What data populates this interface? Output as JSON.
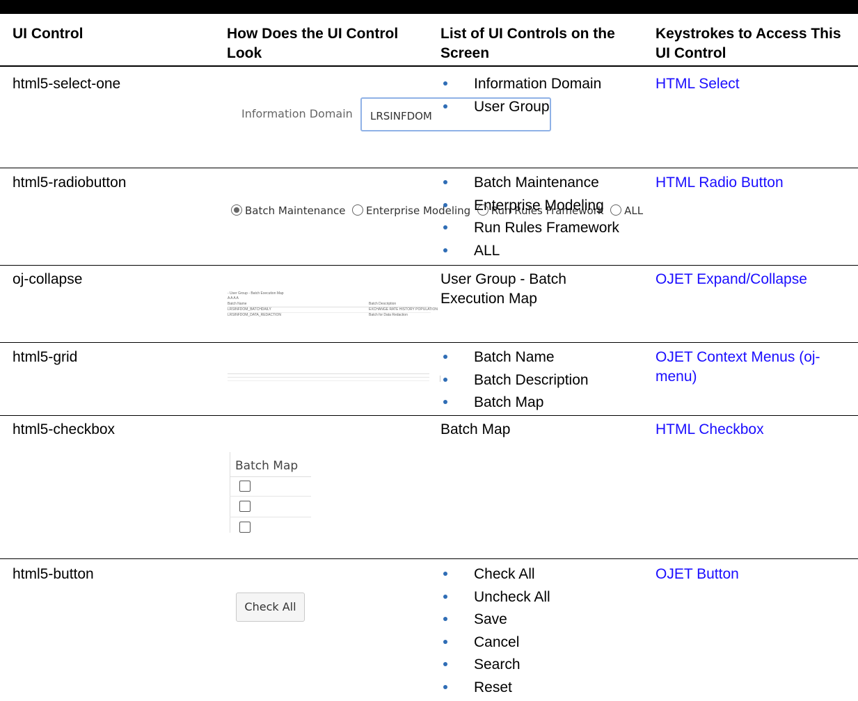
{
  "headers": [
    "UI Control",
    "How Does the UI Control Look",
    "List of UI Controls on the Screen",
    "Keystrokes to Access This UI Control"
  ],
  "rows": [
    {
      "control": "html5-select-one",
      "illustration": {
        "label": "Information Domain",
        "value": "LRSINFDOM"
      },
      "list": [
        "Information Domain",
        "User Group"
      ],
      "link": "HTML Select"
    },
    {
      "control": "html5-radiobutton",
      "illustration": {
        "options": [
          "Batch Maintenance",
          "Enterprise Modeling",
          "Run Rules Framework",
          "ALL"
        ],
        "selected": "Batch Maintenance"
      },
      "list": [
        "Batch Maintenance",
        "Enterprise Modeling",
        "Run Rules Framework",
        "ALL"
      ],
      "link": "HTML Radio Button"
    },
    {
      "control": "oj-collapse",
      "illustration": {
        "title": "- User Group - Batch Execution Map",
        "subtitle": "A A A A",
        "col_name": "Batch Name",
        "col_desc": "Batch Description",
        "rows": [
          {
            "name": "LRSINFDOM_BATCHDAILY",
            "desc": "EXCHANGE RATE HISTORY POPULATION"
          },
          {
            "name": "LRSINFDOM_DATA_REDACTION",
            "desc": "Batch for Data Redaction"
          }
        ]
      },
      "text": "User Group - Batch Execution Map",
      "link": "OJET Expand/Collapse"
    },
    {
      "control": "html5-grid",
      "list": [
        "Batch Name",
        "Batch Description",
        "Batch Map"
      ],
      "link": "OJET Context Menus (oj-menu)"
    },
    {
      "control": "html5-checkbox",
      "illustration": {
        "header": "Batch Map"
      },
      "text": "Batch Map",
      "link": "HTML Checkbox"
    },
    {
      "control": "html5-button",
      "illustration": {
        "label": "Check All"
      },
      "list": [
        "Check All",
        "Uncheck All",
        "Save",
        "Cancel",
        "Search",
        "Reset"
      ],
      "link": "OJET Button"
    }
  ]
}
